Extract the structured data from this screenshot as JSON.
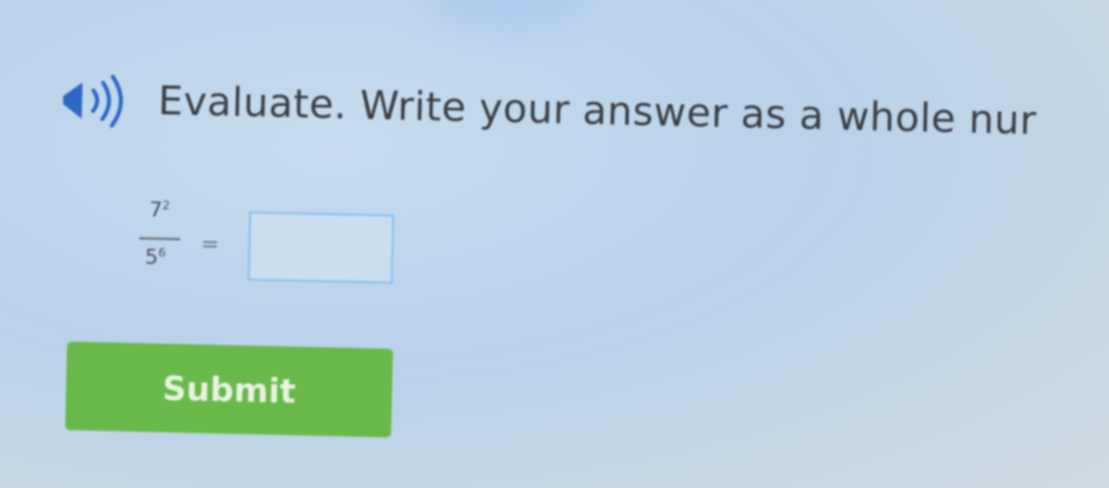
{
  "question": {
    "prompt": "Evaluate. Write your answer as a whole nur",
    "numerator_base": "7",
    "numerator_exponent": "2",
    "denominator_base": "5",
    "denominator_exponent": "6",
    "equals": "=",
    "answer_value": ""
  },
  "submit_label": "Submit",
  "speaker_icon": "speaker-icon",
  "colors": {
    "submit_green": "#69b84a",
    "input_border": "#8fc4ee",
    "speaker_blue": "#2f67c4",
    "text": "#3a3f45"
  }
}
